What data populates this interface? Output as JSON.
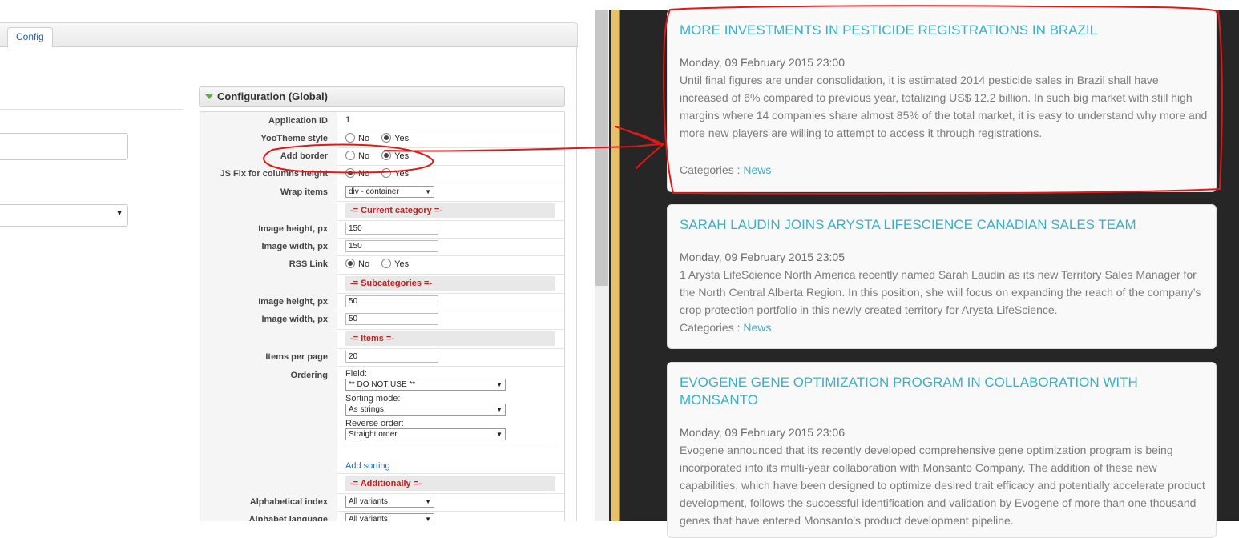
{
  "admin": {
    "tab_label": "Config",
    "config_title": "Configuration (Global)",
    "rows": {
      "app_id": {
        "label": "Application ID",
        "value": "1"
      },
      "yootheme": {
        "label": "YooTheme style",
        "no": "No",
        "yes": "Yes"
      },
      "add_border": {
        "label": "Add border",
        "no": "No",
        "yes": "Yes"
      },
      "js_fix": {
        "label": "JS Fix for columns height",
        "no": "No",
        "yes": "Yes"
      },
      "wrap_items": {
        "label": "Wrap items",
        "value": "div - container"
      },
      "current_category": "-= Current category =-",
      "cc_image_height": {
        "label": "Image height, px",
        "value": "150"
      },
      "cc_image_width": {
        "label": "Image width, px",
        "value": "150"
      },
      "rss_link": {
        "label": "RSS Link",
        "no": "No",
        "yes": "Yes"
      },
      "subcategories": "-= Subcategories =-",
      "sc_image_height": {
        "label": "Image height, px",
        "value": "50"
      },
      "sc_image_width": {
        "label": "Image width, px",
        "value": "50"
      },
      "items": "-= Items =-",
      "items_per_page": {
        "label": "Items per page",
        "value": "20"
      },
      "ordering": {
        "label": "Ordering",
        "field_label": "Field:",
        "field_value": "** DO NOT USE **",
        "sorting_label": "Sorting mode:",
        "sorting_value": "As strings",
        "reverse_label": "Reverse order:",
        "reverse_value": "Straight order",
        "add_sorting": "Add sorting"
      },
      "additionally": "-= Additionally =-",
      "alpha_index": {
        "label": "Alphabetical index",
        "value": "All variants"
      },
      "alpha_language": {
        "label": "Alphabet language",
        "value": "All variants"
      }
    }
  },
  "articles": [
    {
      "title": "MORE INVESTMENTS IN PESTICIDE REGISTRATIONS IN BRAZIL",
      "date": "Monday, 09 February 2015 23:00",
      "body": "Until final figures are under consolidation, it is estimated 2014 pesticide sales in Brazil shall have increased of 6% compared to previous year, totalizing US$ 12.2 billion. In such big market with still high margins where 14 companies share almost 85% of the total market, it is easy to understand why more and more new players are willing to attempt to access it through registrations.",
      "categories_label": "Categories :",
      "category": "News"
    },
    {
      "title": "SARAH LAUDIN JOINS ARYSTA LIFESCIENCE CANADIAN SALES TEAM",
      "date": "Monday, 09 February 2015 23:05",
      "body": "1 Arysta LifeScience North America recently named Sarah Laudin as its new Territory Sales Manager for the North Central Alberta Region. In this position, she will focus on expanding the reach of the company’s crop protection portfolio in this newly created territory for Arysta LifeScience.",
      "categories_label": "Categories :",
      "category": "News"
    },
    {
      "title": "EVOGENE GENE OPTIMIZATION PROGRAM IN COLLABORATION WITH MONSANTO",
      "date": "Monday, 09 February 2015 23:06",
      "body": "Evogene announced that its recently developed comprehensive gene optimization program is being incorporated into its multi-year collaboration with Monsanto Company. The addition of these new capabilities, which have been designed to optimize desired trait efficacy and potentially accelerate product development, follows the successful identification and validation by Evogene of more than one thousand genes that have entered Monsanto's product development pipeline."
    }
  ],
  "colors": {
    "accent": "#3bb0c4",
    "annotation": "#e01818",
    "site_bg": "#262626",
    "section_text": "#b22222"
  }
}
